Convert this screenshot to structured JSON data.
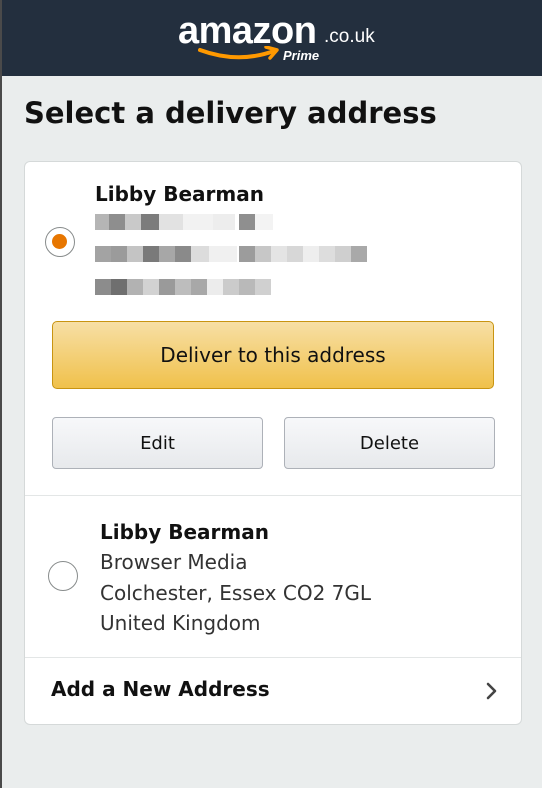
{
  "header": {
    "logo": {
      "word": "amazon",
      "tld": ".co.uk",
      "tagline": "Prime"
    },
    "colors": {
      "background": "#232f3e",
      "smile": "#f90"
    }
  },
  "page_title": "Select a delivery address",
  "addresses": [
    {
      "selected": true,
      "name": "Libby Bearman",
      "redacted_lines": 3
    },
    {
      "selected": false,
      "name": "Libby Bearman",
      "lines": [
        "Browser Media",
        "Colchester, Essex CO2 7GL",
        "United Kingdom"
      ]
    }
  ],
  "actions": {
    "deliver_label": "Deliver to this address",
    "edit_label": "Edit",
    "delete_label": "Delete"
  },
  "add_new_label": "Add a New Address",
  "icons": {
    "radio": "radio-button-icon",
    "chevron": "chevron-right-icon",
    "logo_smile": "amazon-smile-icon"
  },
  "colors": {
    "accent": "#e77600",
    "primary_button": "#f0c14b",
    "page_background": "#eaeded"
  }
}
